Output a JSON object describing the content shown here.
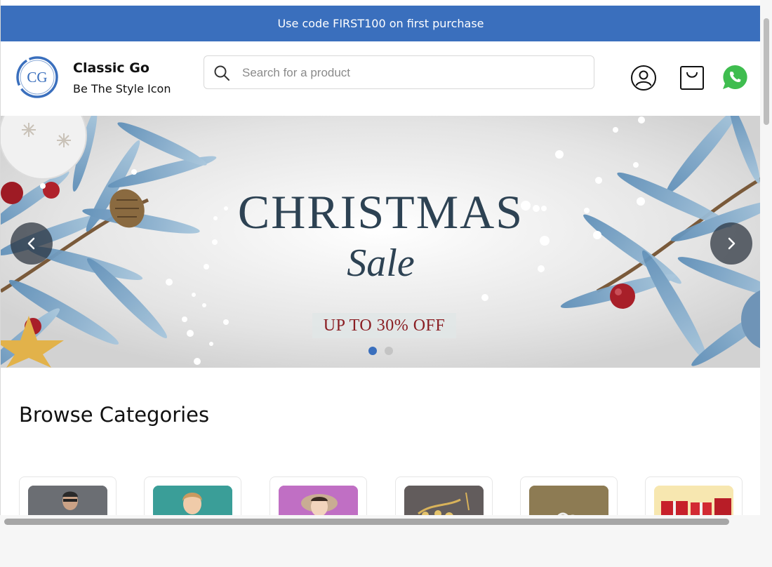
{
  "promo": {
    "text": "Use code FIRST100 on first purchase"
  },
  "header": {
    "logo_text": "CG",
    "brand_name": "Classic Go",
    "tagline": "Be The Style Icon",
    "search": {
      "placeholder": "Search for a product",
      "value": ""
    },
    "icons": [
      "user-icon",
      "shopping-bag-icon",
      "whatsapp-icon"
    ]
  },
  "hero": {
    "title": "CHRISTMAS",
    "subtitle": "Sale",
    "offer": "UP TO 30% OFF",
    "slide_count": 2,
    "active_slide": 1
  },
  "categories": {
    "title": "Browse Categories",
    "items": [
      {
        "icon": "man-in-suit-photo",
        "color": "#6b6e73"
      },
      {
        "icon": "girl-portrait-photo",
        "color": "#3a9e98"
      },
      {
        "icon": "woman-in-hat-photo",
        "color": "#c06fc4"
      },
      {
        "icon": "jewelry-earrings-photo",
        "color": "#5f5a5a"
      },
      {
        "icon": "rings-photo",
        "color": "#8d7b53"
      },
      {
        "icon": "gift-boxes-photo",
        "color": "#f7e7b0"
      }
    ]
  },
  "colors": {
    "promo_bg": "#3a6fbd",
    "logo_blue": "#3a6fbd",
    "whatsapp_green": "#3fbd4f",
    "dot_active": "#3a6fbd",
    "dot_inactive": "#c4c4c4"
  }
}
